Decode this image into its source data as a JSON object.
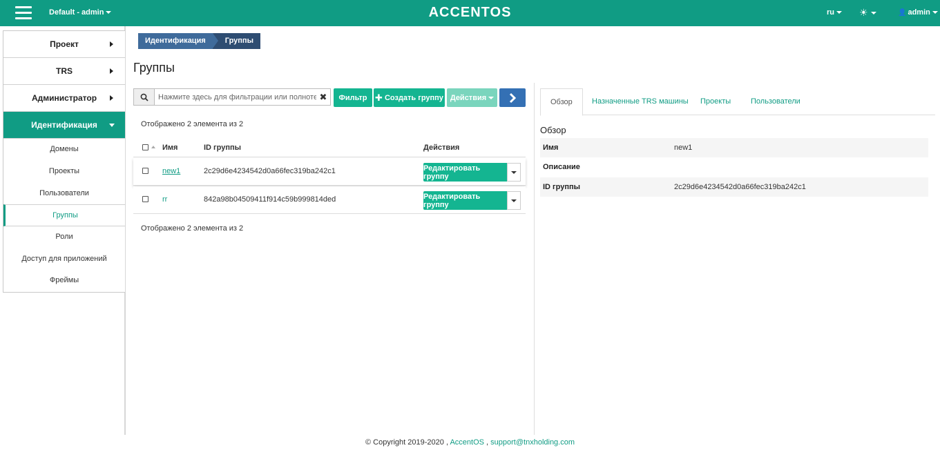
{
  "topbar": {
    "project": "Default - admin",
    "brand": "ACCENTOS",
    "lang": "ru",
    "user": "admin",
    "theme_icon": "sun-icon",
    "user_icon": "user-icon",
    "menu_icon": "hamburger-icon"
  },
  "sidebar": {
    "panels": [
      {
        "label": "Проект"
      },
      {
        "label": "TRS"
      },
      {
        "label": "Администратор"
      },
      {
        "label": "Идентификация"
      }
    ],
    "items": [
      {
        "label": "Домены"
      },
      {
        "label": "Проекты"
      },
      {
        "label": "Пользователи"
      },
      {
        "label": "Группы"
      },
      {
        "label": "Роли"
      },
      {
        "label": "Доступ для приложений"
      },
      {
        "label": "Фреймы"
      }
    ]
  },
  "breadcrumb": [
    "Идентификация",
    "Группы"
  ],
  "page_title": "Группы",
  "toolbar": {
    "search_placeholder": "Нажмите здесь для фильтрации или полнотекс...",
    "filter_label": "Фильтр",
    "create_label": "Создать группу",
    "actions_label": "Действия",
    "next_icon": "chevron-right-icon"
  },
  "table": {
    "count_top": "Отображено 2 элемента из 2",
    "count_bottom": "Отображено 2 элемента из 2",
    "headers": [
      "Имя",
      "ID группы",
      "Действия"
    ],
    "rows": [
      {
        "name": "new1",
        "id": "2c29d6e4234542d0a66fec319ba242c1",
        "action": "Редактировать группу"
      },
      {
        "name": "rr",
        "id": "842a98b04509411f914c59b999814ded",
        "action": "Редактировать группу"
      }
    ]
  },
  "details": {
    "tabs": [
      "Обзор",
      "Назначенные TRS машины",
      "Проекты",
      "Пользователи"
    ],
    "title": "Обзор",
    "fields": [
      {
        "key": "Имя",
        "value": "new1"
      },
      {
        "key": "Описание",
        "value": ""
      },
      {
        "key": "ID группы",
        "value": "2c29d6e4234542d0a66fec319ba242c1"
      }
    ]
  },
  "footer": {
    "copyright": "© Copyright 2019-2020 ,",
    "brand_link": "AccentOS",
    "sep": ",",
    "email": "support@tnxholding.com"
  },
  "colors": {
    "accent": "#109c84",
    "button": "#14b591",
    "breadcrumb": "#3f6b9b"
  }
}
